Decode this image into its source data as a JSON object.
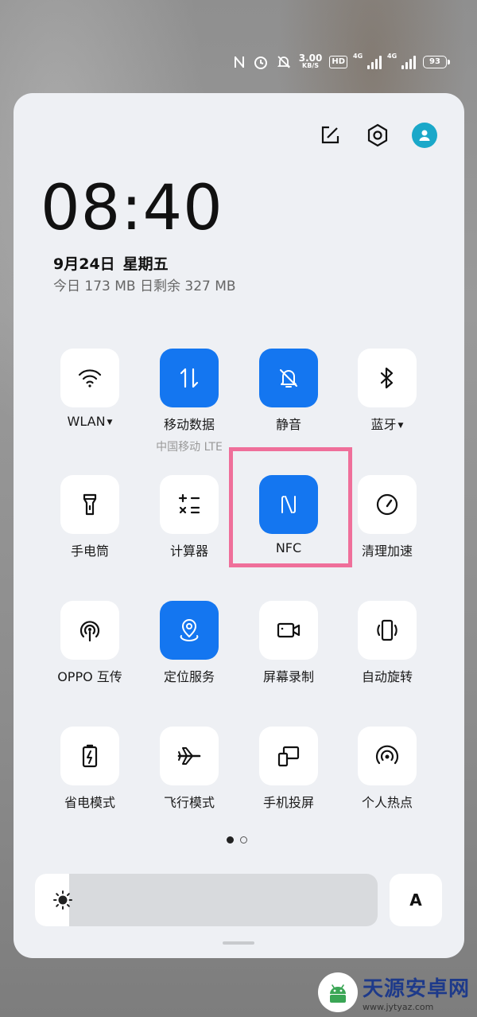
{
  "statusbar": {
    "speed_value": "3.00",
    "speed_unit": "KB/S",
    "hd_label": "HD",
    "sim1_label": "4G",
    "sim2_label": "4G",
    "battery_level": "93",
    "icons": [
      "nfc-icon",
      "alarm-icon",
      "mute-icon",
      "wifi-signal-icon",
      "cell-signal-icon",
      "battery-icon"
    ]
  },
  "header_icons": [
    "edit-icon",
    "settings-gear-icon",
    "user-avatar-icon"
  ],
  "clock": {
    "time": "08:40",
    "date": "9月24日",
    "weekday": "星期五",
    "data_usage": "今日 173 MB 日剩余 327 MB"
  },
  "tiles": [
    {
      "id": "wlan",
      "label": "WLAN",
      "icon": "wifi-icon",
      "active": false,
      "has_menu": true
    },
    {
      "id": "mobile-data",
      "label": "移动数据",
      "sub": "中国移动 LTE",
      "icon": "mobile-data-icon",
      "active": true
    },
    {
      "id": "mute",
      "label": "静音",
      "icon": "bell-off-icon",
      "active": true
    },
    {
      "id": "bluetooth",
      "label": "蓝牙",
      "icon": "bluetooth-icon",
      "active": false,
      "has_menu": true
    },
    {
      "id": "flashlight",
      "label": "手电筒",
      "icon": "flashlight-icon",
      "active": false
    },
    {
      "id": "calculator",
      "label": "计算器",
      "icon": "calculator-icon",
      "active": false
    },
    {
      "id": "nfc",
      "label": "NFC",
      "icon": "nfc-icon",
      "active": true
    },
    {
      "id": "cleanup",
      "label": "清理加速",
      "icon": "speedometer-icon",
      "active": false
    },
    {
      "id": "oppo-share",
      "label": "OPPO 互传",
      "icon": "share-broadcast-icon",
      "active": false
    },
    {
      "id": "location",
      "label": "定位服务",
      "icon": "location-pin-icon",
      "active": true
    },
    {
      "id": "screen-record",
      "label": "屏幕录制",
      "icon": "video-camera-icon",
      "active": false
    },
    {
      "id": "auto-rotate",
      "label": "自动旋转",
      "icon": "rotate-phone-icon",
      "active": false
    },
    {
      "id": "power-saving",
      "label": "省电模式",
      "icon": "battery-saver-icon",
      "active": false
    },
    {
      "id": "airplane",
      "label": "飞行模式",
      "icon": "airplane-icon",
      "active": false
    },
    {
      "id": "screen-cast",
      "label": "手机投屏",
      "icon": "screen-cast-icon",
      "active": false
    },
    {
      "id": "hotspot",
      "label": "个人热点",
      "icon": "hotspot-icon",
      "active": false
    }
  ],
  "pager": {
    "pages": 2,
    "current": 1
  },
  "brightness": {
    "level": 0.1,
    "icon": "sun-icon"
  },
  "auto_brightness": {
    "label": "A"
  },
  "colors": {
    "active": "#1476f0",
    "panel": "#eef0f4",
    "highlight": "#ef6f9a"
  },
  "watermark": {
    "title": "天源安卓网",
    "url": "www.jytyaz.com",
    "icon": "android-logo-icon"
  }
}
